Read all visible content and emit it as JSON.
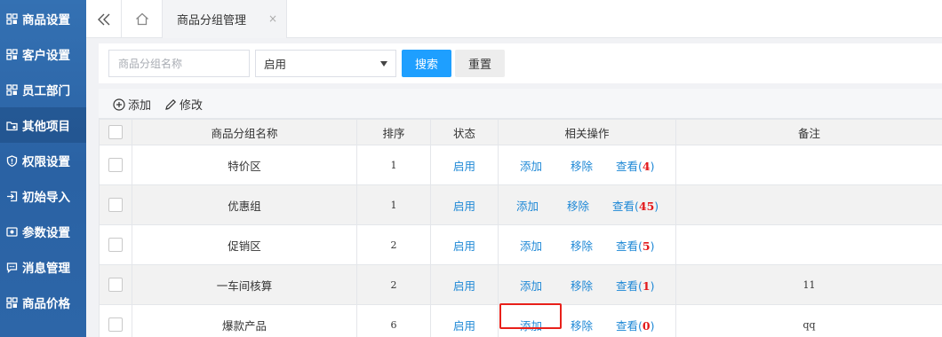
{
  "sidebar": {
    "items": [
      {
        "label": "商品设置",
        "icon": "grid-icon"
      },
      {
        "label": "客户设置",
        "icon": "grid-icon"
      },
      {
        "label": "员工部门",
        "icon": "grid-icon"
      },
      {
        "label": "其他项目",
        "icon": "folder-icon",
        "active": true
      },
      {
        "label": "权限设置",
        "icon": "shield-icon"
      },
      {
        "label": "初始导入",
        "icon": "import-icon"
      },
      {
        "label": "参数设置",
        "icon": "settings-icon"
      },
      {
        "label": "消息管理",
        "icon": "message-icon"
      },
      {
        "label": "商品价格",
        "icon": "grid-icon"
      }
    ]
  },
  "tabs": {
    "collapse_icon": "double-chevron-left-icon",
    "home_icon": "home-icon",
    "active_tab": "商品分组管理",
    "close_icon": "×"
  },
  "search": {
    "name_placeholder": "商品分组名称",
    "status_value": "启用",
    "search_label": "搜索",
    "reset_label": "重置"
  },
  "toolbar": {
    "add_label": "添加",
    "edit_label": "修改"
  },
  "table": {
    "headers": {
      "name": "商品分组名称",
      "sort": "排序",
      "status": "状态",
      "ops": "相关操作",
      "remark": "备注"
    },
    "rows": [
      {
        "name": "特价区",
        "sort": "1",
        "status": "启用",
        "add": "添加",
        "remove": "移除",
        "view": "查看(",
        "count": "4",
        "view_end": ")",
        "remark": ""
      },
      {
        "name": "优惠组",
        "sort": "1",
        "status": "启用",
        "add": "添加",
        "remove": "移除",
        "view": "查看(",
        "count": "45",
        "view_end": ")",
        "remark": ""
      },
      {
        "name": "促销区",
        "sort": "2",
        "status": "启用",
        "add": "添加",
        "remove": "移除",
        "view": "查看(",
        "count": "5",
        "view_end": ")",
        "remark": ""
      },
      {
        "name": "一车间核算",
        "sort": "2",
        "status": "启用",
        "add": "添加",
        "remove": "移除",
        "view": "查看(",
        "count": "1",
        "view_end": ")",
        "remark": "11"
      },
      {
        "name": "爆款产品",
        "sort": "6",
        "status": "启用",
        "add": "添加",
        "remove": "移除",
        "view": "查看(",
        "count": "0",
        "view_end": ")",
        "remark": "qq"
      }
    ]
  },
  "colors": {
    "sidebar_bg": "#2c66a8",
    "primary": "#1e9fff",
    "link": "#1e88d6",
    "count_red": "#e3191b",
    "highlight_border": "#e8201a"
  }
}
